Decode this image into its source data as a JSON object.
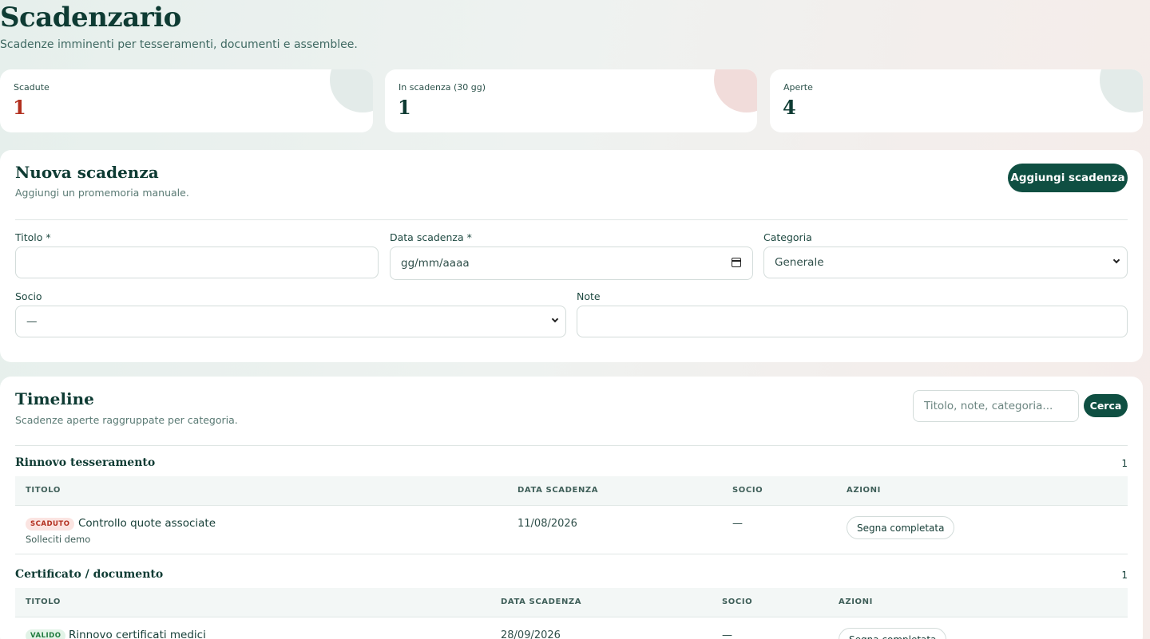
{
  "header": {
    "title": "Scadenzario",
    "subtitle": "Scadenze imminenti per tesseramenti, documenti e assemblee."
  },
  "stats": [
    {
      "label": "Scadute",
      "value": "1",
      "color": "#b2301f",
      "accent": "#e3ebe9"
    },
    {
      "label": "In scadenza (30 gg)",
      "value": "1",
      "color": "#0e3b33",
      "accent": "#f1dcda"
    },
    {
      "label": "Aperte",
      "value": "4",
      "color": "#0e3b33",
      "accent": "#e3ebe9"
    }
  ],
  "new_deadline": {
    "title": "Nuova scadenza",
    "subtitle": "Aggiungi un promemoria manuale.",
    "add_button": "Aggiungi scadenza",
    "fields": {
      "titolo_label": "Titolo *",
      "titolo_value": "",
      "data_label": "Data scadenza *",
      "data_placeholder": "gg/mm/aaaa",
      "categoria_label": "Categoria",
      "categoria_value": "Generale",
      "socio_label": "Socio",
      "socio_value": "—",
      "note_label": "Note",
      "note_value": ""
    }
  },
  "timeline": {
    "title": "Timeline",
    "subtitle": "Scadenze aperte raggruppate per categoria.",
    "search_placeholder": "Titolo, note, categoria...",
    "search_button": "Cerca",
    "groups": [
      {
        "title": "Rinnovo tesseramento",
        "count": "1",
        "headers": [
          "TITOLO",
          "DATA SCADENZA",
          "SOCIO",
          "AZIONI"
        ],
        "rows": [
          {
            "badge": "SCADUTO",
            "title": "Controllo quote associate",
            "note": "Solleciti demo",
            "date": "11/08/2026",
            "socio": "—",
            "action": "Segna completata"
          }
        ]
      },
      {
        "title": "Certificato / documento",
        "count": "1",
        "headers": [
          "TITOLO",
          "DATA SCADENZA",
          "SOCIO",
          "AZIONI"
        ],
        "rows": [
          {
            "badge": "VALIDO",
            "title": "Rinnovo certificati medici",
            "note": "",
            "date": "28/09/2026",
            "socio": "—",
            "action": "Segna completata"
          }
        ]
      }
    ]
  },
  "colors": {
    "primary": "#0f4f42",
    "expired_badge_bg": "#fbe4e1",
    "expired_badge_text": "#b2301f",
    "valid_badge_bg": "#e2f3e7",
    "valid_badge_text": "#1f7a3d"
  }
}
